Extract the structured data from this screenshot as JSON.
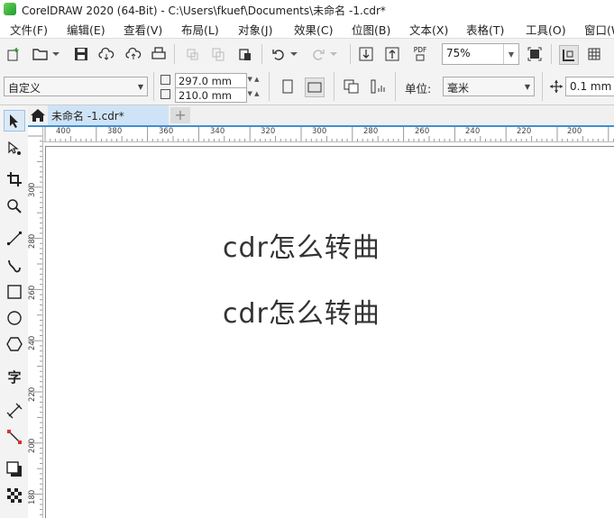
{
  "window": {
    "title": "CorelDRAW 2020 (64-Bit) - C:\\Users\\fkuef\\Documents\\未命名 -1.cdr*"
  },
  "menu": [
    {
      "label": "文件(F)"
    },
    {
      "label": "编辑(E)"
    },
    {
      "label": "查看(V)"
    },
    {
      "label": "布局(L)"
    },
    {
      "label": "对象(J)"
    },
    {
      "label": "效果(C)"
    },
    {
      "label": "位图(B)"
    },
    {
      "label": "文本(X)"
    },
    {
      "label": "表格(T)"
    },
    {
      "label": "工具(O)"
    },
    {
      "label": "窗口(W)"
    }
  ],
  "toolbar": {
    "zoom": "75%",
    "pdf_label": "PDF"
  },
  "properties": {
    "preset": "自定义",
    "width": "297.0 mm",
    "height": "210.0 mm",
    "unit_label": "单位:",
    "unit": "毫米",
    "nudge": "0.1 mm"
  },
  "tabs": {
    "doc": "未命名 -1.cdr*",
    "add": "+"
  },
  "ruler": {
    "h_labels": [
      "400",
      "380",
      "360",
      "340",
      "320",
      "300",
      "280",
      "260",
      "240",
      "220",
      "200"
    ],
    "v_labels": [
      "300",
      "280",
      "260",
      "240",
      "220",
      "200",
      "180"
    ]
  },
  "canvas": {
    "text1": "cdr怎么转曲",
    "text2": "cdr怎么转曲"
  },
  "colors": {
    "accent": "#3d8fd6",
    "tab_active": "#cfe3f6"
  }
}
